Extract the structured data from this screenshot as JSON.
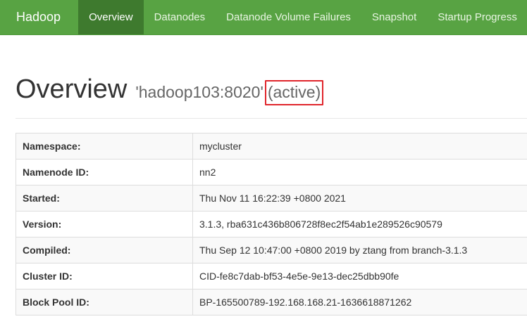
{
  "navbar": {
    "brand": "Hadoop",
    "items": [
      {
        "label": "Overview",
        "active": true
      },
      {
        "label": "Datanodes"
      },
      {
        "label": "Datanode Volume Failures"
      },
      {
        "label": "Snapshot"
      },
      {
        "label": "Startup Progress"
      }
    ],
    "color": "#58a343",
    "active_color": "#3e7a2e"
  },
  "header": {
    "title": "Overview",
    "host": "'hadoop103:8020'",
    "state": "(active)",
    "highlight_color": "#e0252b"
  },
  "info": {
    "rows": [
      {
        "key": "Namespace:",
        "value": "mycluster"
      },
      {
        "key": "Namenode ID:",
        "value": "nn2"
      },
      {
        "key": "Started:",
        "value": "Thu Nov 11 16:22:39 +0800 2021"
      },
      {
        "key": "Version:",
        "value": "3.1.3, rba631c436b806728f8ec2f54ab1e289526c90579"
      },
      {
        "key": "Compiled:",
        "value": "Thu Sep 12 10:47:00 +0800 2019 by ztang from branch-3.1.3"
      },
      {
        "key": "Cluster ID:",
        "value": "CID-fe8c7dab-bf53-4e5e-9e13-dec25dbb90fe"
      },
      {
        "key": "Block Pool ID:",
        "value": "BP-165500789-192.168.168.21-1636618871262"
      }
    ]
  }
}
